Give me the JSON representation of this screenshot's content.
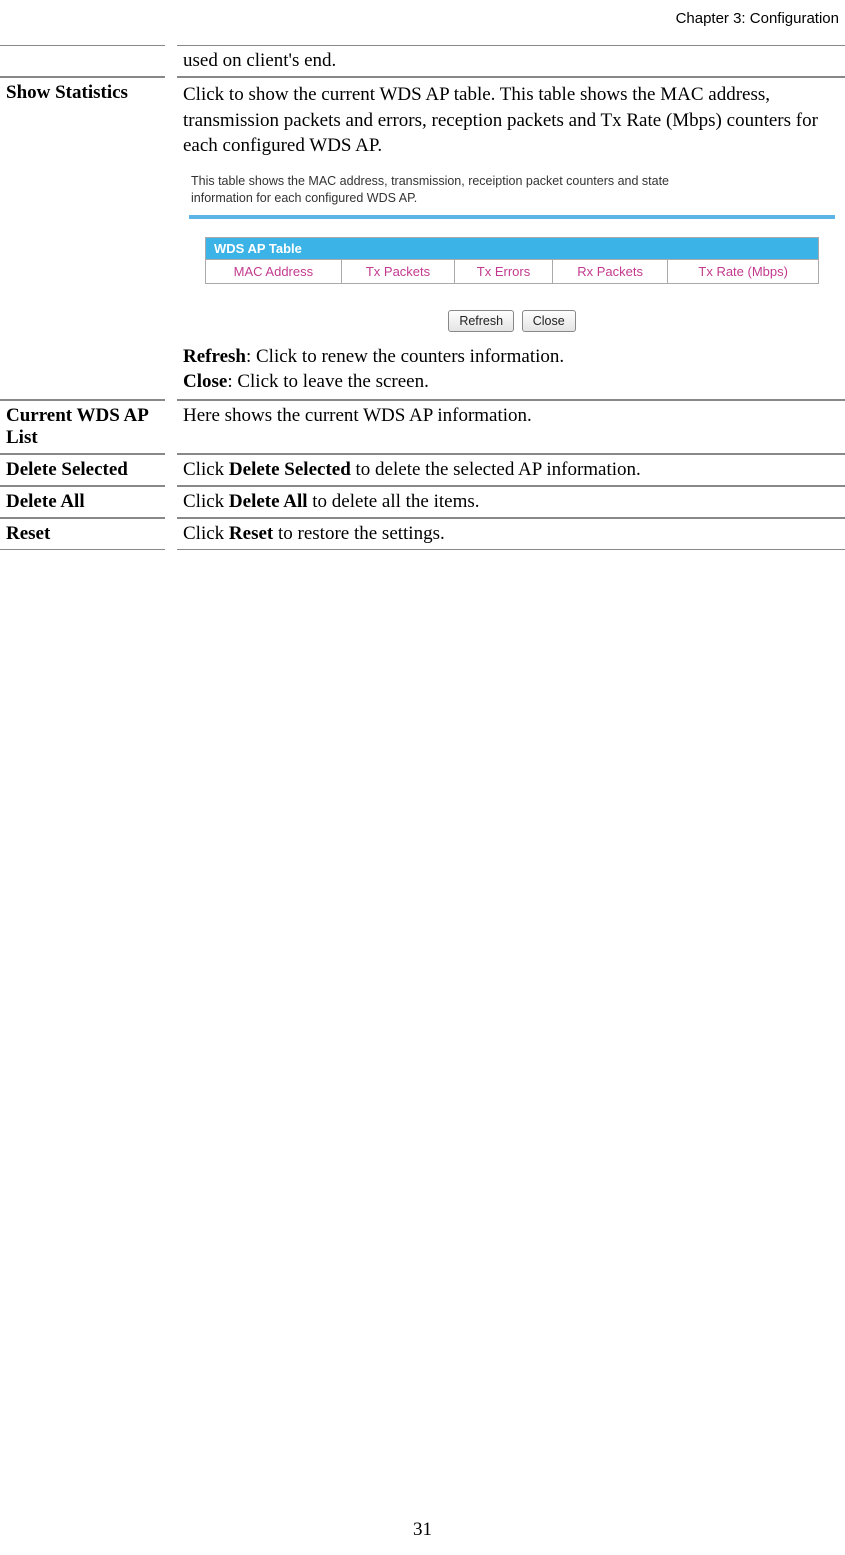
{
  "header": {
    "chapter": "Chapter 3: Configuration"
  },
  "rows": {
    "r0": {
      "label": "",
      "desc": "used on client's end."
    },
    "r1": {
      "label": "Show Statistics",
      "desc_intro": "Click to show the current WDS AP table. This table shows the MAC address, transmission packets and errors, reception packets and Tx Rate (Mbps) counters for each configured WDS AP.",
      "refresh_label": "Refresh",
      "refresh_desc": ": Click to renew the counters information.",
      "close_label": "Close",
      "close_desc": ": Click to leave the screen."
    },
    "r2": {
      "label": "Current WDS AP List",
      "desc": "Here shows the current WDS AP information."
    },
    "r3": {
      "label": "Delete Selected",
      "pre": "Click ",
      "bold": "Delete Selected",
      "post": " to delete the selected AP information."
    },
    "r4": {
      "label": "Delete All",
      "pre": "Click ",
      "bold": "Delete All",
      "post": " to delete all the items."
    },
    "r5": {
      "label": "Reset",
      "pre": "Click ",
      "bold": "Reset",
      "post": " to restore the settings."
    }
  },
  "embedded_screenshot": {
    "intro_line1": "This table shows the MAC address, transmission, receiption packet counters and state",
    "intro_line2": "information for each configured WDS AP.",
    "panel_title": "WDS AP Table",
    "columns": {
      "c0": "MAC Address",
      "c1": "Tx Packets",
      "c2": "Tx Errors",
      "c3": "Rx Packets",
      "c4": "Tx Rate (Mbps)"
    },
    "buttons": {
      "refresh": "Refresh",
      "close": "Close"
    }
  },
  "page_number": "31"
}
